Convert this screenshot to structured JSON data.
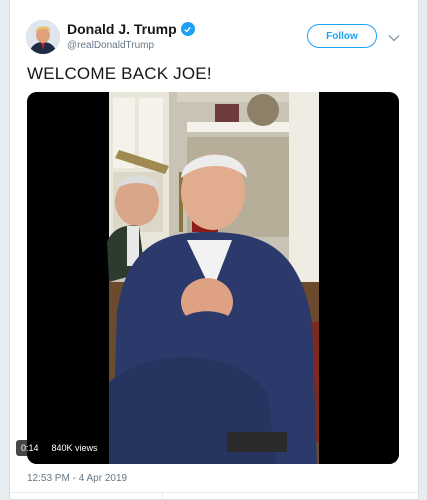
{
  "tweet": {
    "display_name": "Donald J. Trump",
    "handle": "@realDonaldTrump",
    "follow_label": "Follow",
    "text": "WELCOME BACK JOE!",
    "timestamp": "12:53 PM - 4 Apr 2019",
    "verified": true
  },
  "video": {
    "duration": "0:14",
    "views": "840K views"
  },
  "icons": {
    "verified": "verified-badge-icon",
    "caret": "chevron-down-icon"
  },
  "colors": {
    "accent": "#1da1f2",
    "muted_text": "#657786"
  }
}
